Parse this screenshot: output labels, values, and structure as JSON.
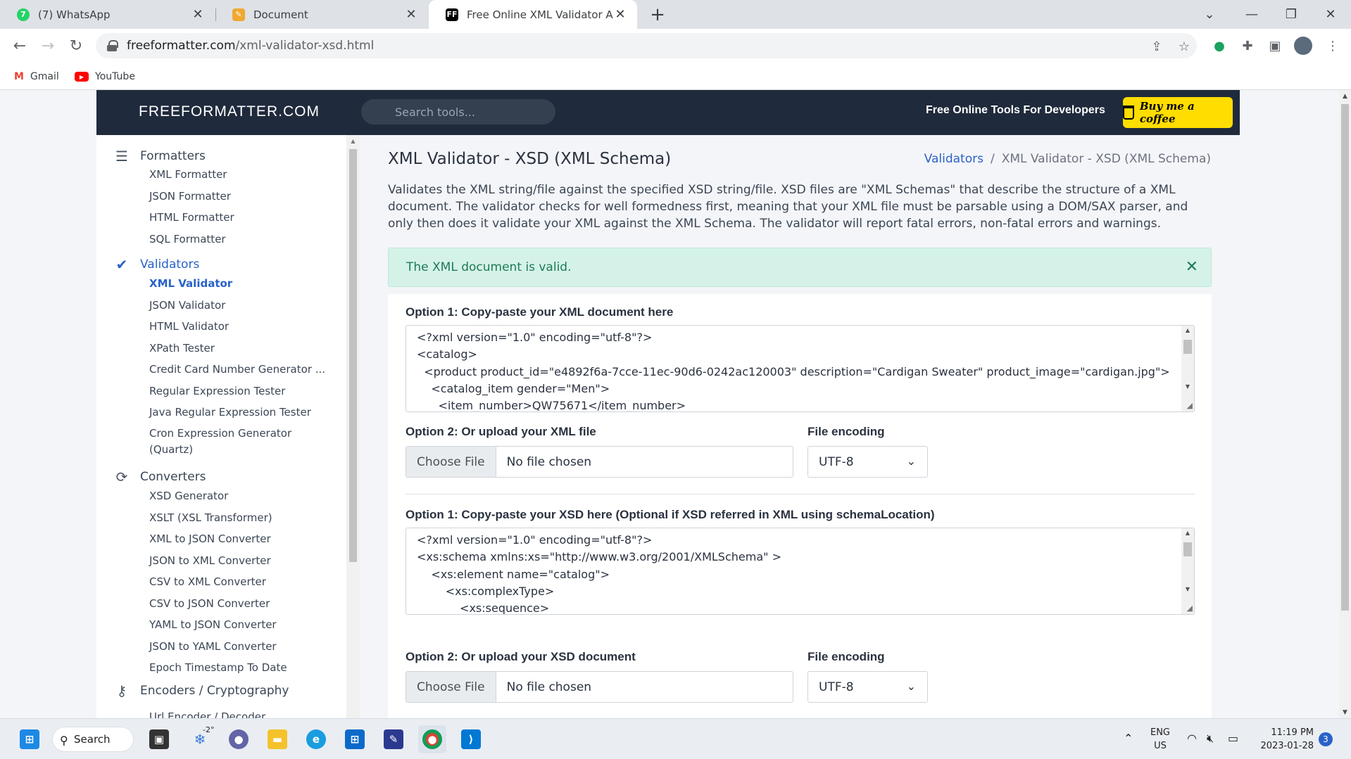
{
  "browser": {
    "tabs": [
      {
        "title": "(7) WhatsApp",
        "icon": "whatsapp-icon",
        "badge": "7",
        "active": false
      },
      {
        "title": "Document",
        "icon": "document-icon",
        "active": false
      },
      {
        "title": "Free Online XML Validator Against",
        "icon": "freeformatter-icon",
        "favicon_text": "FF",
        "active": true
      }
    ],
    "new_tab": "+",
    "url_host": "freeformatter.com",
    "url_path": "/xml-validator-xsd.html",
    "bookmarks": [
      {
        "label": "Gmail",
        "icon": "gmail-icon"
      },
      {
        "label": "YouTube",
        "icon": "youtube-icon"
      }
    ],
    "colors": {
      "accent": "#2a62c9",
      "header": "#1f2a3c",
      "coffee": "#ffdd00",
      "alert_bg": "#d5f2e8"
    }
  },
  "site": {
    "logo": "FREEFORMATTER.COM",
    "search_placeholder": "Search tools...",
    "tagline": "Free Online Tools For Developers",
    "coffee_label": "Buy me a coffee"
  },
  "sidebar": {
    "groups": [
      {
        "label": "Formatters",
        "icon": "formatter-list-icon",
        "items": [
          "XML Formatter",
          "JSON Formatter",
          "HTML Formatter",
          "SQL Formatter"
        ]
      },
      {
        "label": "Validators",
        "icon": "double-check-icon",
        "active": true,
        "items": [
          "XML Validator",
          "JSON Validator",
          "HTML Validator",
          "XPath Tester",
          "Credit Card Number Generator ...",
          "Regular Expression Tester",
          "Java Regular Expression Tester",
          "Cron Expression Generator (Quartz)"
        ]
      },
      {
        "label": "Converters",
        "icon": "refresh-arrows-icon",
        "items": [
          "XSD Generator",
          "XSLT (XSL Transformer)",
          "XML to JSON Converter",
          "JSON to XML Converter",
          "CSV to XML Converter",
          "CSV to JSON Converter",
          "YAML to JSON Converter",
          "JSON to YAML Converter",
          "Epoch Timestamp To Date"
        ]
      },
      {
        "label": "Encoders / Cryptography",
        "icon": "key-icon",
        "items": [
          "Url Encoder / Decoder"
        ]
      }
    ],
    "active_item": "XML Validator"
  },
  "main": {
    "title": "XML Validator - XSD (XML Schema)",
    "breadcrumb": {
      "parent": "Validators",
      "separator": "/",
      "current": "XML Validator - XSD (XML Schema)"
    },
    "description": "Validates the XML string/file against the specified XSD string/file. XSD files are \"XML Schemas\" that describe the structure of a XML document. The validator checks for well formedness first, meaning that your XML file must be parsable using a DOM/SAX parser, and only then does it validate your XML against the XML Schema. The validator will report fatal errors, non-fatal errors and warnings.",
    "alert": "The XML document is valid.",
    "xml": {
      "option1_label": "Option 1: Copy-paste your XML document here",
      "lines": [
        "<?xml version=\"1.0\" encoding=\"utf-8\"?>",
        "<catalog>",
        "  <product product_id=\"e4892f6a-7cce-11ec-90d6-0242ac120003\" description=\"Cardigan Sweater\" product_image=\"cardigan.jpg\">",
        "    <catalog_item gender=\"Men\">",
        "      <item_number>QW75671</item_number>"
      ],
      "option2_label": "Option 2: Or upload your XML file",
      "encoding_label": "File encoding",
      "choose_file": "Choose File",
      "no_file": "No file chosen",
      "encoding_value": "UTF-8"
    },
    "xsd": {
      "option1_label": "Option 1: Copy-paste your XSD here (Optional if XSD referred in XML using schemaLocation)",
      "lines": [
        "<?xml version=\"1.0\" encoding=\"utf-8\"?>",
        "<xs:schema xmlns:xs=\"http://www.w3.org/2001/XMLSchema\" >",
        "    <xs:element name=\"catalog\">",
        "        <xs:complexType>",
        "            <xs:sequence>"
      ],
      "option2_label": "Option 2: Or upload your XSD document",
      "encoding_label": "File encoding",
      "choose_file": "Choose File",
      "no_file": "No file chosen",
      "encoding_value": "UTF-8"
    }
  },
  "taskbar": {
    "search_label": "Search",
    "weather": "-2°",
    "language": "ENG",
    "region": "US",
    "time": "11:19 PM",
    "date": "2023-01-28",
    "notifications": "3"
  }
}
